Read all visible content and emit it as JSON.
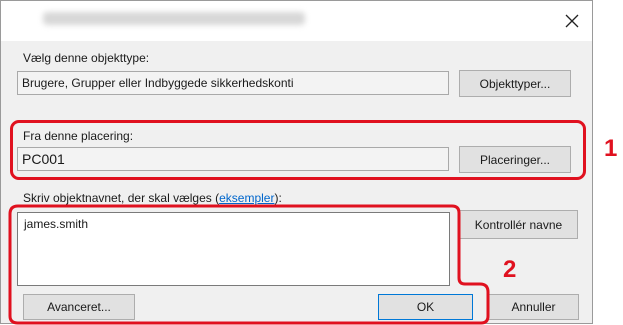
{
  "dialog": {
    "close_glyph": "✕"
  },
  "object_type": {
    "label": "Vælg denne objekttype:",
    "value": "Brugere, Grupper eller Indbyggede sikkerhedskonti",
    "button": "Objekttyper..."
  },
  "location": {
    "label": "Fra denne placering:",
    "value": "PC001",
    "button": "Placeringer..."
  },
  "object_name": {
    "label_prefix": "Skriv objektnavnet, der skal vælges (",
    "link_text": "eksempler",
    "label_suffix": "):",
    "value": "james.smith",
    "check_button": "Kontrollér navne"
  },
  "footer": {
    "advanced_button": "Avanceret...",
    "ok_button": "OK",
    "cancel_button": "Annuller"
  },
  "callouts": {
    "one": "1",
    "two": "2",
    "color": "#e0111f"
  }
}
